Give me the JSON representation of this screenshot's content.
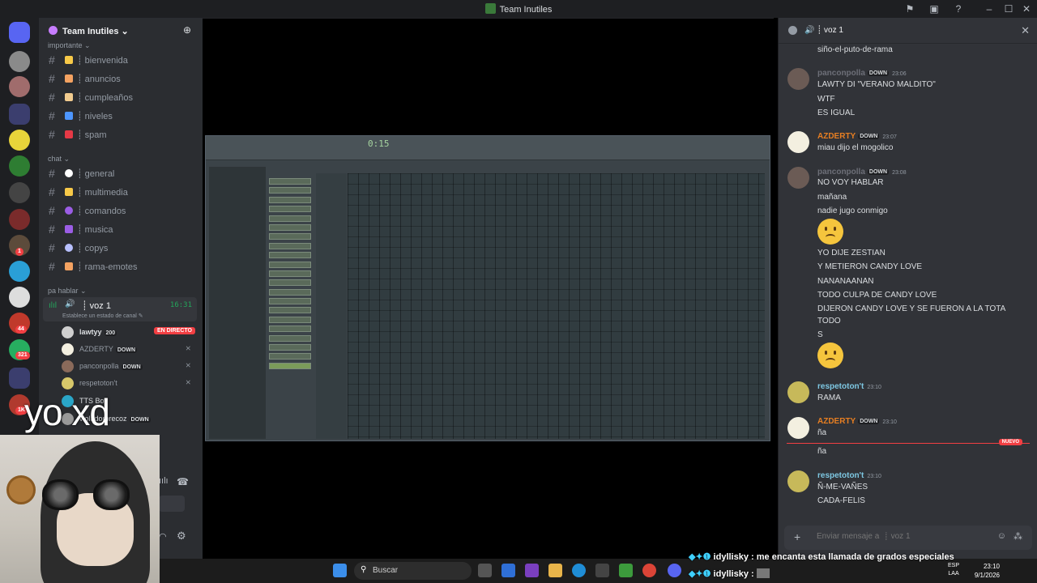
{
  "titlebar": {
    "title": "Team Inutiles"
  },
  "rail": {
    "badges": [
      "1",
      "44",
      "321",
      "1K"
    ]
  },
  "sidebar": {
    "guild_name": "Team Inutiles",
    "categories": [
      {
        "label": "importante",
        "channels": [
          "┊ bienvenida",
          "┊ anuncios",
          "┊ cumpleaños",
          "┊ niveles",
          "┊ spam"
        ]
      },
      {
        "label": "chat",
        "channels": [
          "┊ general",
          "┊ multimedia",
          "┊ comandos",
          "┊ musica",
          "┊ copys",
          "┊ rama-emotes"
        ]
      },
      {
        "label": "pa hablar"
      }
    ],
    "voice": {
      "name": "┊ voz 1",
      "time": "16:31",
      "status_prompt": "Establece un estado de canal",
      "users": [
        {
          "name": "lawtyy",
          "tag": "200",
          "live": "EN DIRECTO"
        },
        {
          "name": "AZDERTY",
          "tag": "DOWN"
        },
        {
          "name": "panconpolla",
          "tag": "DOWN"
        },
        {
          "name": "respetoton't"
        },
        {
          "name": "TTS Bot"
        },
        {
          "name": "violadorprecoz",
          "tag": "DOWN"
        }
      ]
    }
  },
  "stream": {
    "fl_time": "0:15"
  },
  "chat": {
    "header": "┊ voz 1",
    "new_label": "NUEVO",
    "placeholder": "Enviar mensaje a  ┊ voz 1",
    "first_line": "siño-el-puto-de-rama",
    "messages": [
      {
        "author": "panconpolla",
        "tag": "DOWN",
        "time": "23:06",
        "color": "#6d6f78",
        "lines": [
          "LAWTY DI \"VERANO MALDITO\"",
          "WTF",
          "ES IGUAL"
        ]
      },
      {
        "author": "AZDERTY",
        "tag": "DOWN",
        "time": "23:07",
        "color": "#e67e22",
        "lines": [
          "miau dijo el mogolico"
        ]
      },
      {
        "author": "panconpolla",
        "tag": "DOWN",
        "time": "23:08",
        "color": "#6d6f78",
        "lines": [
          "NO VOY HABLAR",
          "mañana",
          "nadie jugo conmigo",
          "YO DIJE ZESTIAN",
          "Y METIERON CANDY LOVE",
          "NANANAANAN",
          "TODO CULPA DE CANDY LOVE",
          "DIJERON CANDY LOVE Y SE FUERON A LA TOTA",
          "TODO",
          "S"
        ]
      },
      {
        "author": "respetoton't",
        "time": "23:10",
        "color": "#7ec8e3",
        "lines": [
          "RAMA"
        ]
      },
      {
        "author": "AZDERTY",
        "tag": "DOWN",
        "time": "23:10",
        "color": "#e67e22",
        "lines": [
          "ña",
          "ña"
        ]
      },
      {
        "author": "respetoton't",
        "time": "23:10",
        "color": "#7ec8e3",
        "lines": [
          "Ñ-ME-VAÑES",
          "CADA-FELIS"
        ]
      }
    ]
  },
  "overlay": {
    "big_text": "yo xd",
    "stream_chat": [
      {
        "user": "idyllisky",
        "text": "me encanta esta llamada de grados especiales"
      },
      {
        "user": "idyllisky",
        "text": ""
      }
    ]
  },
  "taskbar": {
    "search_label": "Buscar",
    "lang_top": "ESP",
    "lang_bottom": "LAA",
    "time": "23:10",
    "date": "9/1/2026"
  }
}
